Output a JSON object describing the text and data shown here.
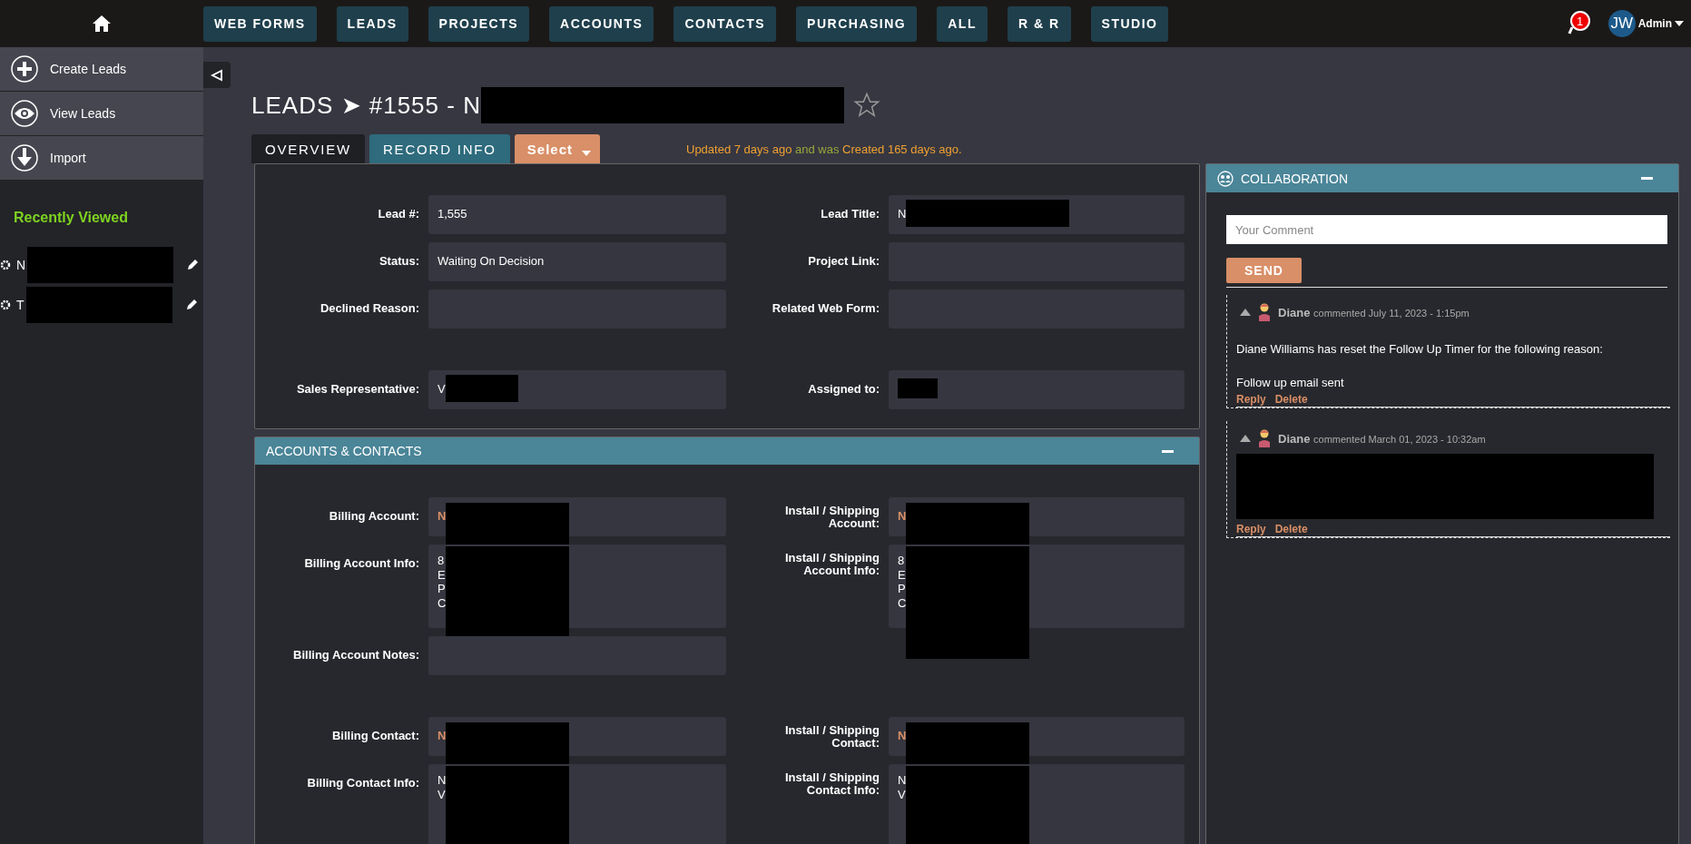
{
  "nav": {
    "items": [
      {
        "label": "WEB FORMS"
      },
      {
        "label": "LEADS"
      },
      {
        "label": "PROJECTS"
      },
      {
        "label": "ACCOUNTS"
      },
      {
        "label": "CONTACTS"
      },
      {
        "label": "PURCHASING"
      },
      {
        "label": "ALL"
      },
      {
        "label": "R & R"
      },
      {
        "label": "STUDIO"
      }
    ]
  },
  "notifications": {
    "count": "1"
  },
  "user": {
    "initials": "JW",
    "name": "Admin"
  },
  "sidebar": {
    "actions": [
      {
        "label": "Create Leads",
        "kind": "plus"
      },
      {
        "label": "View Leads",
        "kind": "eye"
      },
      {
        "label": "Import",
        "kind": "download"
      }
    ],
    "recent_title": "Recently Viewed",
    "recent": [
      {
        "label": "N",
        "redacted": true
      },
      {
        "label": "T",
        "redacted": true
      }
    ]
  },
  "header": {
    "section": "LEADS",
    "separator": "➤",
    "record": "#1555 - N",
    "redacted": true,
    "starred": false
  },
  "tabs": [
    {
      "label": "OVERVIEW",
      "selected": true
    },
    {
      "label": "RECORD INFO",
      "selected": false
    }
  ],
  "select_button": "Select",
  "status_line": {
    "updated": "Updated 7 days ago",
    "joiner": "and was",
    "created": "Created 165 days ago."
  },
  "overview": {
    "groups": [
      [
        [
          {
            "label": "Lead #:",
            "value": "1,555"
          },
          {
            "label": "Lead Title:",
            "value": "N",
            "redacted": true
          }
        ],
        [
          {
            "label": "Status:",
            "value": "Waiting On Decision"
          },
          {
            "label": "Project Link:"
          }
        ],
        [
          {
            "label": "Declined Reason:"
          },
          {
            "label": "Related Web Form:"
          }
        ]
      ],
      [
        [
          {
            "label": "Sales Representative:",
            "value": "V",
            "redacted": true
          },
          {
            "label": "Assigned to:",
            "redacted": true
          }
        ]
      ]
    ]
  },
  "accounts": {
    "title": "ACCOUNTS & CONTACTS",
    "groups": [
      [
        [
          {
            "label": "Billing Account:",
            "value": "N",
            "link": true,
            "redacted": true
          },
          {
            "label": "Install / Shipping Account:",
            "value": "N",
            "link": true,
            "redacted": true
          }
        ],
        [
          {
            "label": "Billing Account Info:",
            "lines": [
              "8",
              "E",
              "P",
              "C"
            ],
            "redacted": true
          },
          {
            "label": "Install / Shipping Account Info:",
            "lines": [
              "8",
              "E",
              "P",
              "C"
            ],
            "redacted": true
          }
        ],
        [
          {
            "label": "Billing Account Notes:"
          }
        ]
      ],
      [
        [
          {
            "label": "Billing Contact:",
            "value": "N",
            "link": true,
            "redacted": true
          },
          {
            "label": "Install / Shipping Contact:",
            "value": "N",
            "link": true,
            "redacted": true
          }
        ],
        [
          {
            "label": "Billing Contact Info:",
            "lines": [
              "N",
              "V"
            ],
            "redacted": true
          },
          {
            "label": "Install / Shipping Contact Info:",
            "lines": [
              "N",
              "V"
            ],
            "redacted": true
          }
        ]
      ]
    ]
  },
  "collaboration": {
    "title": "COLLABORATION",
    "placeholder": "Your Comment",
    "send": "SEND",
    "comments": [
      {
        "author": "Diane",
        "verb": "commented",
        "date": "July 11, 2023 - 1:15pm",
        "body": [
          "Diane Williams has reset the Follow Up Timer for the following reason:",
          "Follow up email sent"
        ],
        "redacted": false,
        "actions": [
          "Reply",
          "Delete"
        ]
      },
      {
        "author": "Diane",
        "verb": "commented",
        "date": "March 01, 2023 - 10:32am",
        "redacted": true,
        "actions": [
          "Reply",
          "Delete"
        ]
      }
    ]
  }
}
